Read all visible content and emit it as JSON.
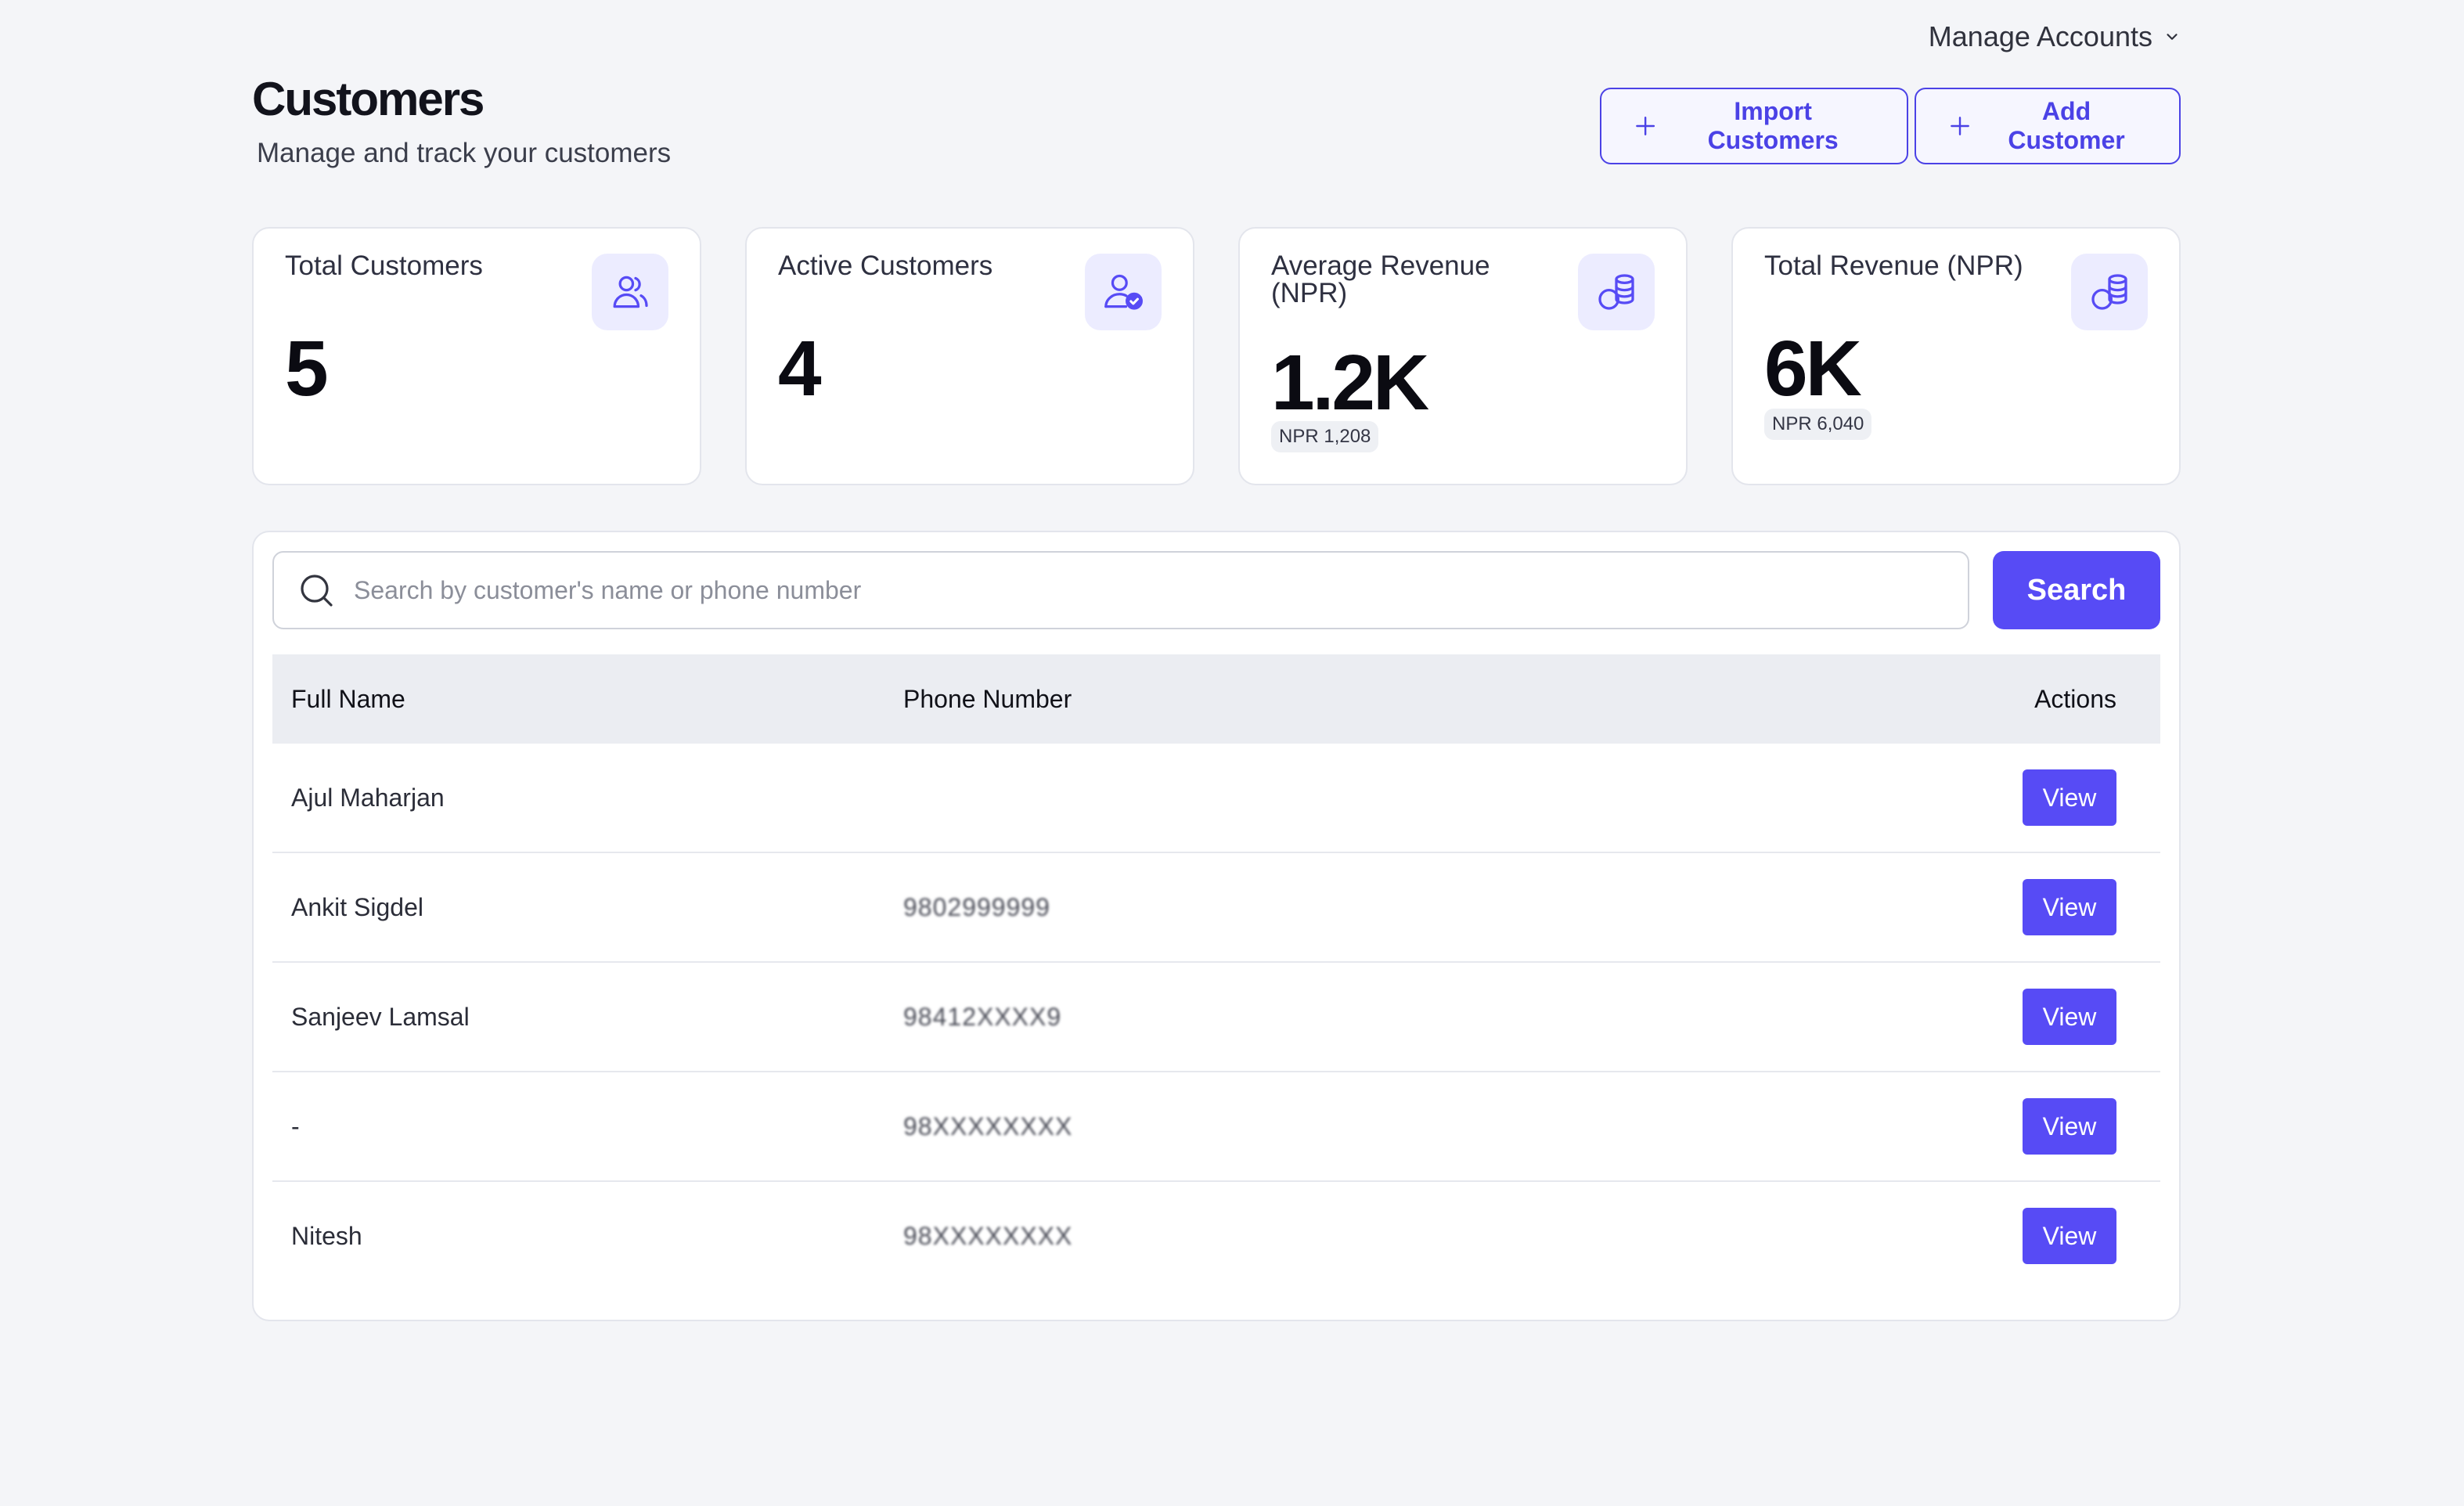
{
  "header": {
    "manage_accounts": "Manage Accounts",
    "title": "Customers",
    "subtitle": "Manage and track your customers",
    "import_label": "Import Customers",
    "add_label": "Add Customer"
  },
  "stats": [
    {
      "label": "Total Customers",
      "value": "5",
      "sub": ""
    },
    {
      "label": "Active Customers",
      "value": "4",
      "sub": ""
    },
    {
      "label": "Average Revenue (NPR)",
      "value": "1.2K",
      "sub": "NPR 1,208"
    },
    {
      "label": "Total Revenue (NPR)",
      "value": "6K",
      "sub": "NPR 6,040"
    }
  ],
  "search": {
    "placeholder": "Search by customer's name or phone number",
    "value": "",
    "button_label": "Search"
  },
  "table": {
    "columns": [
      "Full Name",
      "Phone Number",
      "Actions"
    ],
    "rows": [
      {
        "name": "Ajul Maharjan",
        "phone": "",
        "action": "View"
      },
      {
        "name": "Ankit Sigdel",
        "phone": "9802999999",
        "action": "View"
      },
      {
        "name": "Sanjeev Lamsal",
        "phone": "98412XXXX9",
        "action": "View"
      },
      {
        "name": "-",
        "phone": "98XXXXXXXX",
        "action": "View"
      },
      {
        "name": "Nitesh",
        "phone": "98XXXXXXXX",
        "action": "View"
      }
    ]
  },
  "colors": {
    "accent": "#574bf5",
    "accent_outline": "#4b42e6",
    "icon_bg": "#ececff",
    "page_bg": "#f4f5f8"
  },
  "icons": {
    "manage_accounts": "chevron-down-icon",
    "import": "plus-icon",
    "add": "plus-icon",
    "total_customers": "users-icon",
    "active_customers": "user-check-icon",
    "average_revenue": "coins-icon",
    "total_revenue": "coins-icon",
    "search": "search-icon"
  }
}
